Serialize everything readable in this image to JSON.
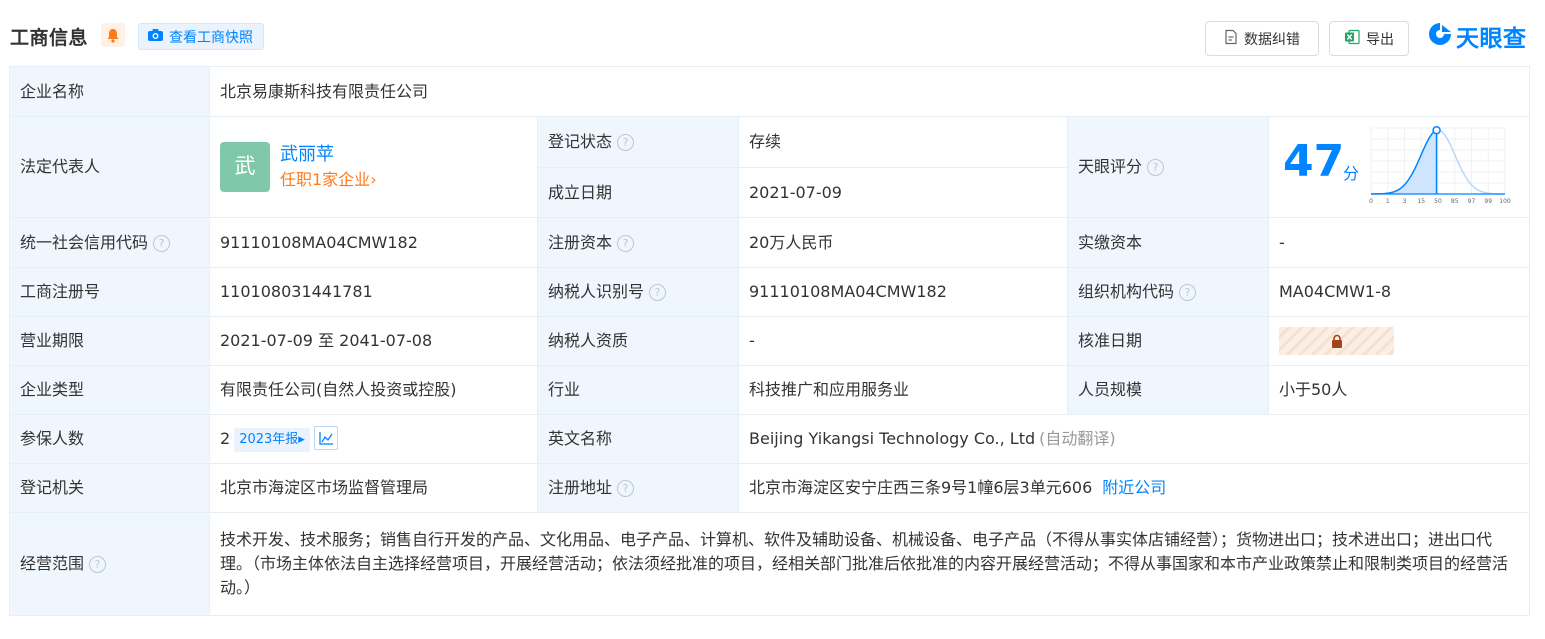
{
  "header": {
    "title": "工商信息",
    "snapshot_label": "查看工商快照",
    "correct_label": "数据纠错",
    "export_label": "导出",
    "logo_text": "天眼查",
    "brand_color": "#0084ff"
  },
  "icons": {
    "bell": "bell-icon",
    "camera": "camera-icon",
    "correct": "document-edit-icon",
    "export": "excel-icon",
    "help": "question-circle-icon",
    "lock": "lock-icon",
    "trend": "trend-chart-icon"
  },
  "table": {
    "company_name": {
      "label": "企业名称",
      "value": "北京易康斯科技有限责任公司"
    },
    "legal_rep": {
      "label": "法定代表人",
      "avatar_char": "武",
      "name": "武丽苹",
      "positions": "任职1家企业",
      "chevron": "›",
      "avatar_color": "#7fc8a8"
    },
    "reg_status": {
      "label": "登记状态",
      "value": "存续",
      "value_color": "#12a54a"
    },
    "found_date": {
      "label": "成立日期",
      "value": "2021-07-09"
    },
    "tianyan_score": {
      "label": "天眼评分",
      "score": "47",
      "unit": "分",
      "score_value": 47,
      "axis_ticks": [
        "0",
        "1",
        "3",
        "15",
        "50",
        "85",
        "97",
        "99",
        "100"
      ]
    },
    "credit_code": {
      "label": "统一社会信用代码",
      "value": "91110108MA04CMW182"
    },
    "reg_capital": {
      "label": "注册资本",
      "value": "20万人民币"
    },
    "paid_capital": {
      "label": "实缴资本",
      "value": "-"
    },
    "reg_number": {
      "label": "工商注册号",
      "value": "110108031441781"
    },
    "taxpayer_id": {
      "label": "纳税人识别号",
      "value": "91110108MA04CMW182"
    },
    "org_code": {
      "label": "组织机构代码",
      "value": "MA04CMW1-8"
    },
    "biz_term": {
      "label": "营业期限",
      "value": "2021-07-09 至 2041-07-08"
    },
    "taxpayer_qual": {
      "label": "纳税人资质",
      "value": "-"
    },
    "approval_date": {
      "label": "核准日期",
      "value_state": "locked"
    },
    "company_type": {
      "label": "企业类型",
      "value": "有限责任公司(自然人投资或控股)"
    },
    "industry": {
      "label": "行业",
      "value": "科技推广和应用服务业"
    },
    "staff_size": {
      "label": "人员规模",
      "value": "小于50人"
    },
    "insured": {
      "label": "参保人数",
      "value": "2",
      "year_badge": "2023年报",
      "badge_arrow": "▸"
    },
    "english_name": {
      "label": "英文名称",
      "value": "Beijing Yikangsi Technology Co., Ltd",
      "note": "(自动翻译)"
    },
    "reg_authority": {
      "label": "登记机关",
      "value": "北京市海淀区市场监督管理局"
    },
    "reg_address": {
      "label": "注册地址",
      "value": "北京市海淀区安宁庄西三条9号1幢6层3单元606",
      "nearby_link": "附近公司"
    },
    "biz_scope": {
      "label": "经营范围",
      "value": "技术开发、技术服务；销售自行开发的产品、文化用品、电子产品、计算机、软件及辅助设备、机械设备、电子产品（不得从事实体店铺经营）；货物进出口；技术进出口；进出口代理。（市场主体依法自主选择经营项目，开展经营活动；依法须经批准的项目，经相关部门批准后依批准的内容开展经营活动；不得从事国家和本市产业政策禁止和限制类项目的经营活动。）"
    }
  }
}
